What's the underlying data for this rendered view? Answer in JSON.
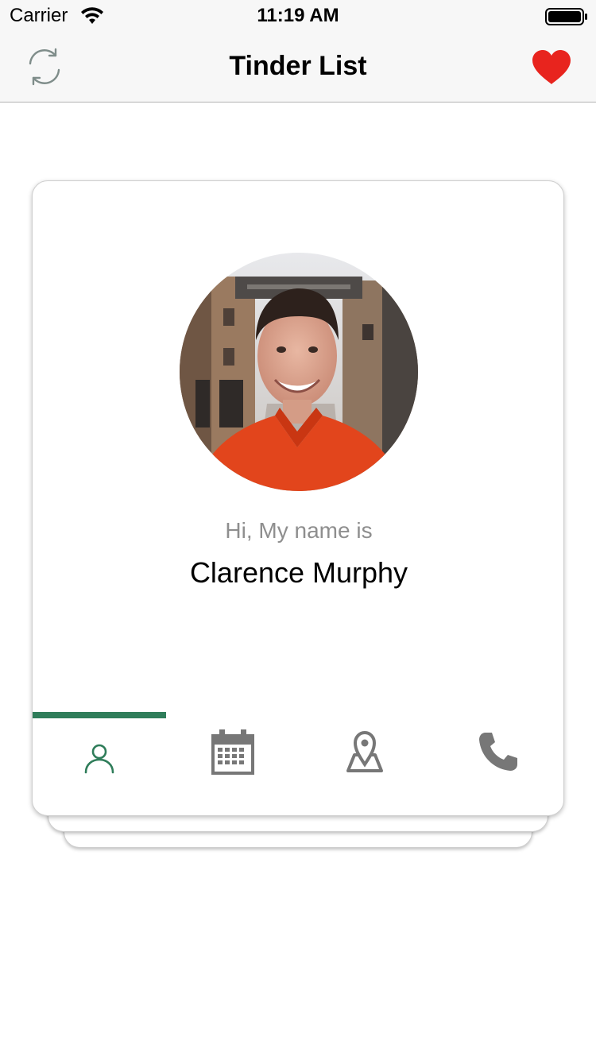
{
  "status_bar": {
    "carrier": "Carrier",
    "time": "11:19 AM",
    "wifi_icon": "wifi-icon",
    "battery_icon": "battery-icon"
  },
  "nav_bar": {
    "title": "Tinder List",
    "left_icon": "refresh-icon",
    "right_icon": "heart-icon",
    "heart_color": "#e8241e"
  },
  "card": {
    "greeting": "Hi, My name is",
    "name": "Clarence Murphy",
    "avatar_icon": "profile-photo",
    "tabs": [
      {
        "id": "person",
        "icon": "person-icon",
        "active": true
      },
      {
        "id": "calendar",
        "icon": "calendar-icon",
        "active": false
      },
      {
        "id": "location",
        "icon": "location-icon",
        "active": false
      },
      {
        "id": "phone",
        "icon": "phone-icon",
        "active": false
      }
    ],
    "accent_color": "#2f7d5a",
    "inactive_icon_color": "#777777"
  }
}
